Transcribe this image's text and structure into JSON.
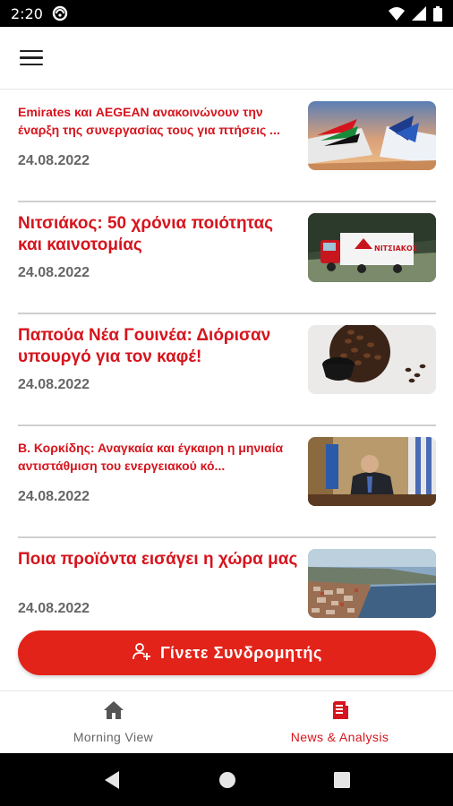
{
  "status_bar": {
    "time": "2:20",
    "icons": [
      "do-not-disturb-icon",
      "wifi-icon",
      "signal-icon",
      "battery-icon"
    ]
  },
  "app_bar": {
    "menu_icon": "hamburger-menu-icon"
  },
  "articles": [
    {
      "title": "Emirates και AEGEAN ανακοινώνουν την έναρξη της συνεργασίας τους για πτήσεις ...",
      "date": "24.08.2022",
      "thumbnail": "airplane-tails-image"
    },
    {
      "title": "Νιτσιάκος: 50 χρόνια ποιότητας και καινοτομίας",
      "date": "24.08.2022",
      "thumbnail": "delivery-truck-image",
      "thumbnail_text": "ΝΙΤΣΙΑΚΟΣ"
    },
    {
      "title": "Παπούα Νέα Γουινέα: Διόρισαν υπουργό για τον καφέ!",
      "date": "24.08.2022",
      "thumbnail": "coffee-beans-image"
    },
    {
      "title": "Β. Κορκίδης: Αναγκαία και έγκαιρη η μηνιαία αντιστάθμιση του ενεργειακού κό...",
      "date": "24.08.2022",
      "thumbnail": "man-at-desk-image"
    },
    {
      "title": "Ποια προϊόντα εισάγει η χώρα μας",
      "date": "24.08.2022",
      "thumbnail": "port-city-image"
    }
  ],
  "subscribe": {
    "label": "Γίνετε Συνδρομητής",
    "icon": "add-user-icon"
  },
  "bottom_nav": [
    {
      "label": "Morning View",
      "icon": "home-icon",
      "active": false
    },
    {
      "label": "News & Analysis",
      "icon": "news-document-icon",
      "active": true
    }
  ],
  "colors": {
    "accent": "#d6141d",
    "button": "#e2231a",
    "date_text": "#666666",
    "divider": "#cfcfcf"
  }
}
